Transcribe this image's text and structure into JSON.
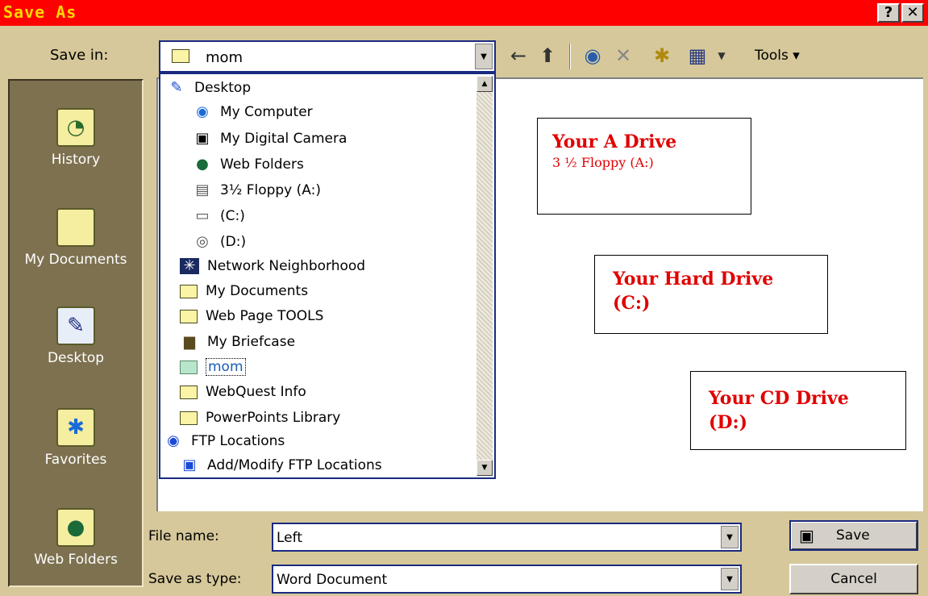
{
  "window": {
    "title": "Save As",
    "help_label": "?",
    "close_label": "✕"
  },
  "save_in": {
    "label": "Save in:",
    "value": "mom"
  },
  "toolbar": {
    "tools_label": "Tools"
  },
  "places": [
    {
      "label": "History"
    },
    {
      "label": "My Documents"
    },
    {
      "label": "Desktop"
    },
    {
      "label": "Favorites"
    },
    {
      "label": "Web Folders"
    }
  ],
  "dropdown_items": [
    {
      "label": "Desktop"
    },
    {
      "label": "My Computer"
    },
    {
      "label": "My Digital Camera"
    },
    {
      "label": "Web Folders"
    },
    {
      "label": "3½ Floppy (A:)"
    },
    {
      "label": "(C:)"
    },
    {
      "label": "(D:)"
    },
    {
      "label": "Network Neighborhood"
    },
    {
      "label": "My Documents"
    },
    {
      "label": "Web Page TOOLS"
    },
    {
      "label": "My Briefcase"
    },
    {
      "label": "mom"
    },
    {
      "label": "WebQuest Info"
    },
    {
      "label": "PowerPoints Library"
    },
    {
      "label": "FTP Locations"
    },
    {
      "label": "Add/Modify FTP Locations"
    }
  ],
  "notes": {
    "a_drive": {
      "title": "Your  A Drive",
      "sub": "3 ½ Floppy (A:)"
    },
    "c_drive": {
      "title": "Your  Hard Drive",
      "sub": "(C:)"
    },
    "d_drive": {
      "title": "Your  CD Drive",
      "sub": "(D:)"
    }
  },
  "file_name": {
    "label": "File name:",
    "value": "Left"
  },
  "save_as_type": {
    "label": "Save as type:",
    "value": "Word Document"
  },
  "buttons": {
    "save": "Save",
    "cancel": "Cancel"
  },
  "colors": {
    "title_bar": "#ff0000",
    "title_text": "#ffd800",
    "note_text": "#e00000",
    "places_bar": "#7d7150"
  }
}
